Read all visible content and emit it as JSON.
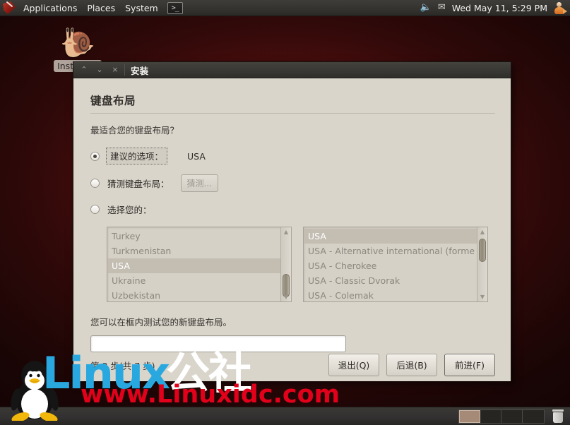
{
  "top_panel": {
    "logo_icon": "distro-dragon-logo",
    "menus": [
      "Applications",
      "Places",
      "System"
    ],
    "terminal_launcher_label": ">_",
    "volume_icon": "volume-icon",
    "mail_icon": "envelope-icon",
    "clock": "Wed May 11,  5:29 PM",
    "avatar_icon": "user-avatar-icon"
  },
  "desktop": {
    "icon": {
      "label": "Install Ba",
      "glyph": "☸"
    }
  },
  "window": {
    "title": "安装",
    "minimize_glyph": "⌃",
    "maximize_glyph": "⌄",
    "close_glyph": "×"
  },
  "page": {
    "heading": "键盘布局",
    "question": "最适合您的键盘布局？",
    "options": [
      {
        "label": "建议的选项：",
        "value": "USA",
        "selected": true
      },
      {
        "label": "猜测键盘布局：",
        "button": "猜测...",
        "selected": false
      },
      {
        "label": "选择您的：",
        "selected": false
      }
    ],
    "country_list": [
      {
        "label": "Turkey",
        "selected": false
      },
      {
        "label": "Turkmenistan",
        "selected": false
      },
      {
        "label": "USA",
        "selected": true
      },
      {
        "label": "Ukraine",
        "selected": false
      },
      {
        "label": "Uzbekistan",
        "selected": false
      }
    ],
    "variant_list": [
      {
        "label": "USA",
        "selected": true
      },
      {
        "label": "USA - Alternative international (forme",
        "selected": false
      },
      {
        "label": "USA - Cherokee",
        "selected": false
      },
      {
        "label": "USA - Classic Dvorak",
        "selected": false
      },
      {
        "label": "USA - Colemak",
        "selected": false
      }
    ],
    "test_label": "您可以在框内测试您的新键盘布局。",
    "test_input_value": "",
    "test_input_placeholder": ""
  },
  "footer": {
    "step_text": "第 3 步(共 7 步)",
    "buttons": [
      {
        "label": "退出(Q)"
      },
      {
        "label": "后退(B)"
      },
      {
        "label": "前进(F)"
      }
    ]
  },
  "bottom_panel": {
    "workspaces": 4,
    "active_workspace": 1,
    "trash_icon": "trash-icon"
  },
  "watermark": {
    "brand_latin": "Linux",
    "brand_cn": "公社",
    "url": "www.Linuxidc.com"
  },
  "colors": {
    "desktop": "#4a0d0d",
    "panel": "#353330",
    "dialog": "#d9d5cb",
    "accent_blue": "#29a8e0",
    "accent_red": "#e2001a"
  }
}
